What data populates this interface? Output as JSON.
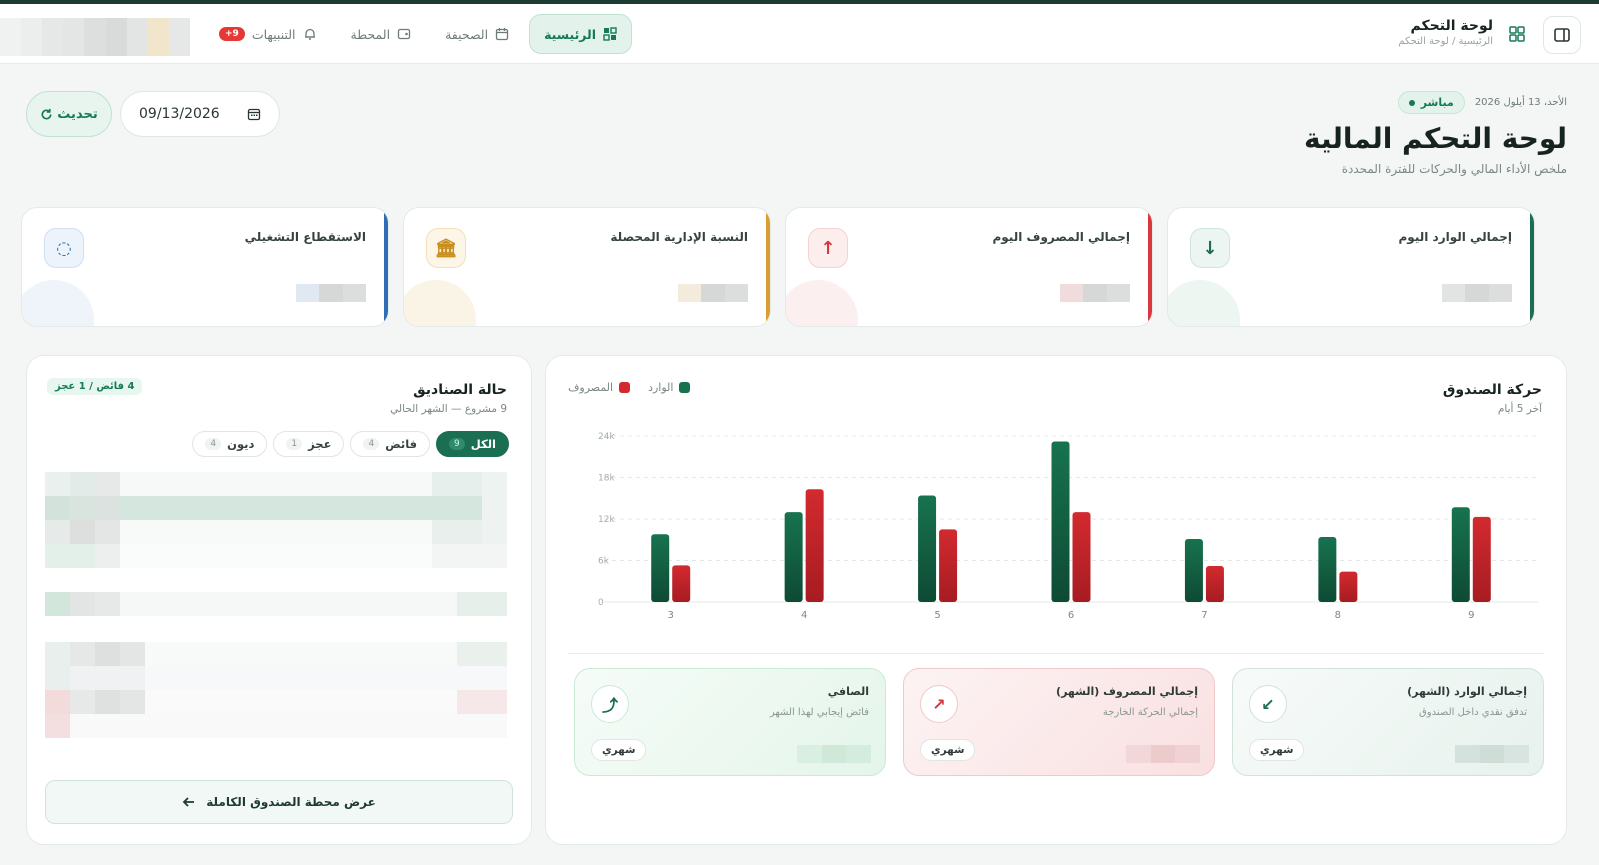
{
  "nav": {
    "title": "لوحة التحكم",
    "breadcrumb": "الرئيسية / لوحة التحكم",
    "links": [
      {
        "label": "الرئيسية",
        "icon": "dashboard-icon",
        "active": true
      },
      {
        "label": "الصحيفة",
        "icon": "calendar-icon",
        "active": false
      },
      {
        "label": "المحطة",
        "icon": "wallet-icon",
        "active": false
      },
      {
        "label": "التنبيهات",
        "icon": "bell-icon",
        "active": false
      }
    ],
    "notif_badge": "9+"
  },
  "header": {
    "live_label": "مباشر",
    "date_text": "الأحد، 13 أيلول 2026",
    "title": "لوحة التحكم المالية",
    "subtitle": "ملخص الأداء المالي والحركات للفترة المحددة",
    "date_value": "09/13/2026",
    "refresh_label": "تحديث"
  },
  "stats": [
    {
      "label": "إجمالي الوارد اليوم",
      "icon": "arrow-down-icon",
      "color": "#1b6e52"
    },
    {
      "label": "إجمالي المصروف اليوم",
      "icon": "arrow-up-icon",
      "color": "#d9363e"
    },
    {
      "label": "النسبة الإدارية المحصلة",
      "icon": "bank-icon",
      "color": "#d9a030"
    },
    {
      "label": "الاستقطاع التشغيلي",
      "icon": "refresh-icon",
      "color": "#2f6db5"
    }
  ],
  "fund_movement": {
    "title": "حركة الصندوق",
    "subtitle": "آخر 5 أيام",
    "legend": {
      "in": "الوارد",
      "out": "المصروف"
    },
    "summaries": [
      {
        "title": "إجمالي الوارد (الشهر)",
        "desc": "تدفق نقدي داخل الصندوق",
        "pill": "شهري",
        "icon": "arrow-down-left-icon"
      },
      {
        "title": "إجمالي المصروف (الشهر)",
        "desc": "إجمالي الحركة الخارجة",
        "pill": "شهري",
        "icon": "arrow-up-right-icon"
      },
      {
        "title": "الصافي",
        "desc": "فائض إيجابي لهذا الشهر",
        "pill": "شهري",
        "icon": "trend-up-icon"
      }
    ]
  },
  "chart_data": {
    "type": "bar",
    "categories": [
      "3",
      "4",
      "5",
      "6",
      "7",
      "8",
      "9"
    ],
    "series": [
      {
        "name": "الوارد",
        "values": [
          9800,
          13000,
          15400,
          23200,
          9100,
          9400,
          13700
        ],
        "color": "#17734f"
      },
      {
        "name": "المصروف",
        "values": [
          5300,
          16300,
          10500,
          13000,
          5200,
          4400,
          12300
        ],
        "color": "#d22a2f"
      }
    ],
    "yticks": [
      "0",
      "6k",
      "12k",
      "18k",
      "24k"
    ],
    "ylim": [
      0,
      24000
    ],
    "grid": true,
    "legend_position": "top-left"
  },
  "funds": {
    "title": "حالة الصناديق",
    "subtitle": "9 مشروع — الشهر الحالي",
    "status_badge": "4 فائض / 1 عجز",
    "tabs": [
      {
        "label": "الكل",
        "count": "9",
        "active": true
      },
      {
        "label": "فائض",
        "count": "4",
        "active": false
      },
      {
        "label": "عجز",
        "count": "1",
        "active": false
      },
      {
        "label": "ديون",
        "count": "4",
        "active": false
      }
    ],
    "full_view_label": "عرض محطة الصندوق الكاملة"
  }
}
